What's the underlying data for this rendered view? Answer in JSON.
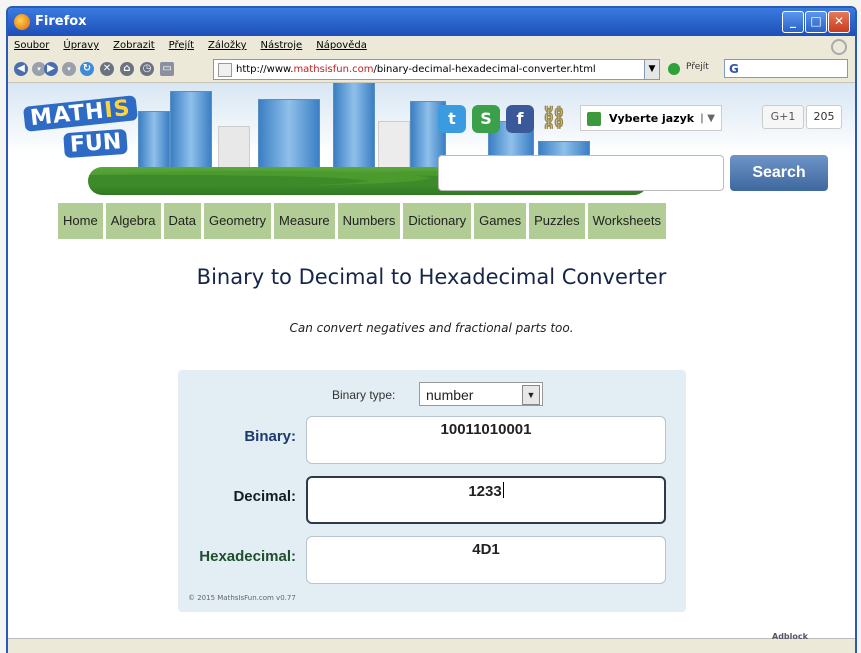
{
  "window": {
    "title": "Firefox"
  },
  "menu": [
    "Soubor",
    "Úpravy",
    "Zobrazit",
    "Přejít",
    "Záložky",
    "Nástroje",
    "Nápověda"
  ],
  "toolbar": {
    "url_prefix": "http://www.",
    "url_host": "mathsisfun.com",
    "url_path": "/binary-decimal-hexadecimal-converter.html",
    "go_label": "Přejít"
  },
  "banner": {
    "logo_top_1": "MATH",
    "logo_top_2": "IS",
    "logo_bottom": "FUN",
    "language_label": "Vyberte jazyk",
    "gplus_label": "G+1",
    "gplus_count": "205",
    "search_button": "Search",
    "search_placeholder": ""
  },
  "nav": [
    "Home",
    "Algebra",
    "Data",
    "Geometry",
    "Measure",
    "Numbers",
    "Dictionary",
    "Games",
    "Puzzles",
    "Worksheets"
  ],
  "page": {
    "title": "Binary to Decimal to Hexadecimal Converter",
    "subtitle": "Can convert negatives and fractional parts too."
  },
  "converter": {
    "binary_type_label": "Binary type:",
    "binary_type_value": "number",
    "binary_label": "Binary:",
    "binary_value": "10011010001",
    "decimal_label": "Decimal:",
    "decimal_value": "1233",
    "hex_label": "Hexadecimal:",
    "hex_value": "4D1",
    "label_colors": {
      "binary": "#1c3a6c",
      "decimal": "#151c26",
      "hex": "#1f4f2c"
    },
    "copyright": "© 2015 MathsIsFun.com v0.77"
  },
  "statusbar": {
    "adblock": "Adblock"
  }
}
